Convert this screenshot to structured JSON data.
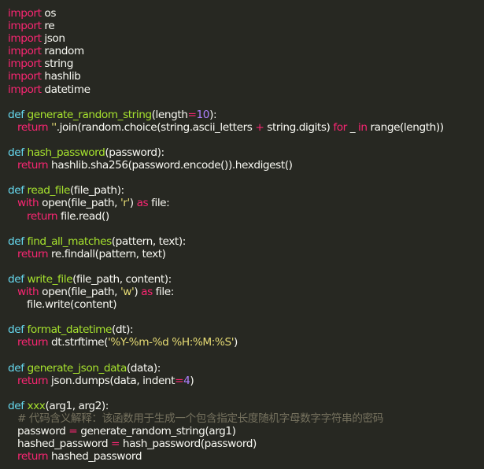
{
  "lines": [
    [
      {
        "t": "import",
        "c": "kw"
      },
      {
        "t": " os",
        "c": "pl"
      }
    ],
    [
      {
        "t": "import",
        "c": "kw"
      },
      {
        "t": " re",
        "c": "pl"
      }
    ],
    [
      {
        "t": "import",
        "c": "kw"
      },
      {
        "t": " json",
        "c": "pl"
      }
    ],
    [
      {
        "t": "import",
        "c": "kw"
      },
      {
        "t": " random",
        "c": "pl"
      }
    ],
    [
      {
        "t": "import",
        "c": "kw"
      },
      {
        "t": " string",
        "c": "pl"
      }
    ],
    [
      {
        "t": "import",
        "c": "kw"
      },
      {
        "t": " hashlib",
        "c": "pl"
      }
    ],
    [
      {
        "t": "import",
        "c": "kw"
      },
      {
        "t": " datetime",
        "c": "pl"
      }
    ],
    [],
    [
      {
        "t": "def",
        "c": "df"
      },
      {
        "t": " ",
        "c": "pl"
      },
      {
        "t": "generate_random_string",
        "c": "fn"
      },
      {
        "t": "(length",
        "c": "pl"
      },
      {
        "t": "=",
        "c": "op"
      },
      {
        "t": "10",
        "c": "nm"
      },
      {
        "t": "):",
        "c": "pl"
      }
    ],
    [
      {
        "t": "return",
        "c": "kw"
      },
      {
        "t": " ",
        "c": "pl"
      },
      {
        "t": "''",
        "c": "st"
      },
      {
        "t": ".join(random.choice(string.ascii_letters ",
        "c": "pl"
      },
      {
        "t": "+",
        "c": "op"
      },
      {
        "t": " string.digits) ",
        "c": "pl"
      },
      {
        "t": "for",
        "c": "kw"
      },
      {
        "t": " _ ",
        "c": "pl"
      },
      {
        "t": "in",
        "c": "kw"
      },
      {
        "t": " range(length))",
        "c": "pl"
      }
    ],
    [],
    [
      {
        "t": "def",
        "c": "df"
      },
      {
        "t": " ",
        "c": "pl"
      },
      {
        "t": "hash_password",
        "c": "fn"
      },
      {
        "t": "(password):",
        "c": "pl"
      }
    ],
    [
      {
        "t": "return",
        "c": "kw"
      },
      {
        "t": " hashlib.sha256(password.encode()).hexdigest()",
        "c": "pl"
      }
    ],
    [],
    [
      {
        "t": "def",
        "c": "df"
      },
      {
        "t": " ",
        "c": "pl"
      },
      {
        "t": "read_file",
        "c": "fn"
      },
      {
        "t": "(file_path):",
        "c": "pl"
      }
    ],
    [
      {
        "t": "with",
        "c": "kw"
      },
      {
        "t": " open(file_path, ",
        "c": "pl"
      },
      {
        "t": "'r'",
        "c": "st"
      },
      {
        "t": ") ",
        "c": "pl"
      },
      {
        "t": "as",
        "c": "kw"
      },
      {
        "t": " file:",
        "c": "pl"
      }
    ],
    [
      {
        "t": "return",
        "c": "kw"
      },
      {
        "t": " file.read()",
        "c": "pl"
      }
    ],
    [],
    [
      {
        "t": "def",
        "c": "df"
      },
      {
        "t": " ",
        "c": "pl"
      },
      {
        "t": "find_all_matches",
        "c": "fn"
      },
      {
        "t": "(pattern, text):",
        "c": "pl"
      }
    ],
    [
      {
        "t": "return",
        "c": "kw"
      },
      {
        "t": " re.findall(pattern, text)",
        "c": "pl"
      }
    ],
    [],
    [
      {
        "t": "def",
        "c": "df"
      },
      {
        "t": " ",
        "c": "pl"
      },
      {
        "t": "write_file",
        "c": "fn"
      },
      {
        "t": "(file_path, content):",
        "c": "pl"
      }
    ],
    [
      {
        "t": "with",
        "c": "kw"
      },
      {
        "t": " open(file_path, ",
        "c": "pl"
      },
      {
        "t": "'w'",
        "c": "st"
      },
      {
        "t": ") ",
        "c": "pl"
      },
      {
        "t": "as",
        "c": "kw"
      },
      {
        "t": " file:",
        "c": "pl"
      }
    ],
    [
      {
        "t": "file.write(content)",
        "c": "pl"
      }
    ],
    [],
    [
      {
        "t": "def",
        "c": "df"
      },
      {
        "t": " ",
        "c": "pl"
      },
      {
        "t": "format_datetime",
        "c": "fn"
      },
      {
        "t": "(dt):",
        "c": "pl"
      }
    ],
    [
      {
        "t": "return",
        "c": "kw"
      },
      {
        "t": " dt.strftime(",
        "c": "pl"
      },
      {
        "t": "'%Y-%m-%d %H:%M:%S'",
        "c": "st"
      },
      {
        "t": ")",
        "c": "pl"
      }
    ],
    [],
    [
      {
        "t": "def",
        "c": "df"
      },
      {
        "t": " ",
        "c": "pl"
      },
      {
        "t": "generate_json_data",
        "c": "fn"
      },
      {
        "t": "(data):",
        "c": "pl"
      }
    ],
    [
      {
        "t": "return",
        "c": "kw"
      },
      {
        "t": " json.dumps(data, indent",
        "c": "pl"
      },
      {
        "t": "=",
        "c": "op"
      },
      {
        "t": "4",
        "c": "nm"
      },
      {
        "t": ")",
        "c": "pl"
      }
    ],
    [],
    [
      {
        "t": "def",
        "c": "df"
      },
      {
        "t": " ",
        "c": "pl"
      },
      {
        "t": "xxx",
        "c": "fn"
      },
      {
        "t": "(arg1, arg2):",
        "c": "pl"
      }
    ],
    [
      {
        "t": "# 代码含义解释：该函数用于生成一个包含指定长度随机字母数字字符串的密码",
        "c": "cm"
      }
    ],
    [
      {
        "t": "password ",
        "c": "pl"
      },
      {
        "t": "=",
        "c": "op"
      },
      {
        "t": " generate_random_string(arg1)",
        "c": "pl"
      }
    ],
    [
      {
        "t": "hashed_password ",
        "c": "pl"
      },
      {
        "t": "=",
        "c": "op"
      },
      {
        "t": " hash_password(password)",
        "c": "pl"
      }
    ],
    [
      {
        "t": "return",
        "c": "kw"
      },
      {
        "t": " hashed_password",
        "c": "pl"
      }
    ]
  ]
}
